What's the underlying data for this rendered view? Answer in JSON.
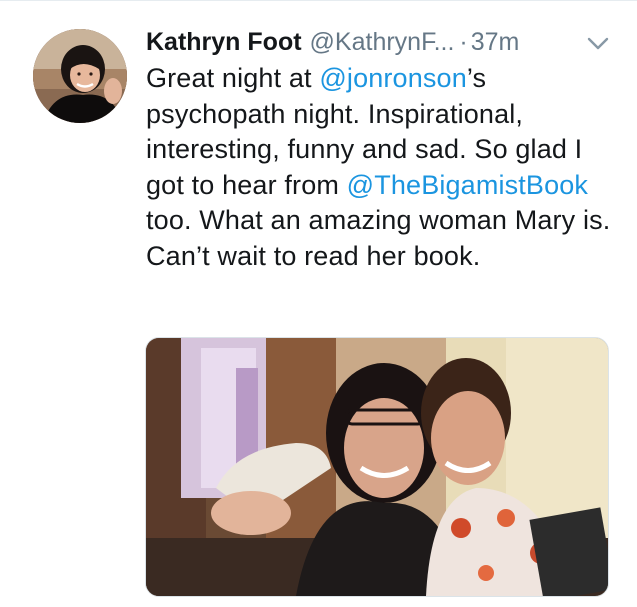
{
  "tweet": {
    "author_name": "Kathryn Foot",
    "author_handle": "@KathrynF...",
    "separator": "·",
    "timestamp": "37m",
    "text_segments": {
      "t1": "Great night at ",
      "m1": "@jonronson",
      "t2": "’s psychopath night. Inspirational, interesting, funny and sad. So glad I got to hear from ",
      "m2": "@TheBigamistBook",
      "t3": " too. What an amazing woman Mary is. Can’t wait to read her book."
    },
    "mention_color": "#1b95e0"
  },
  "icons": {
    "more": "chevron-down-icon"
  }
}
